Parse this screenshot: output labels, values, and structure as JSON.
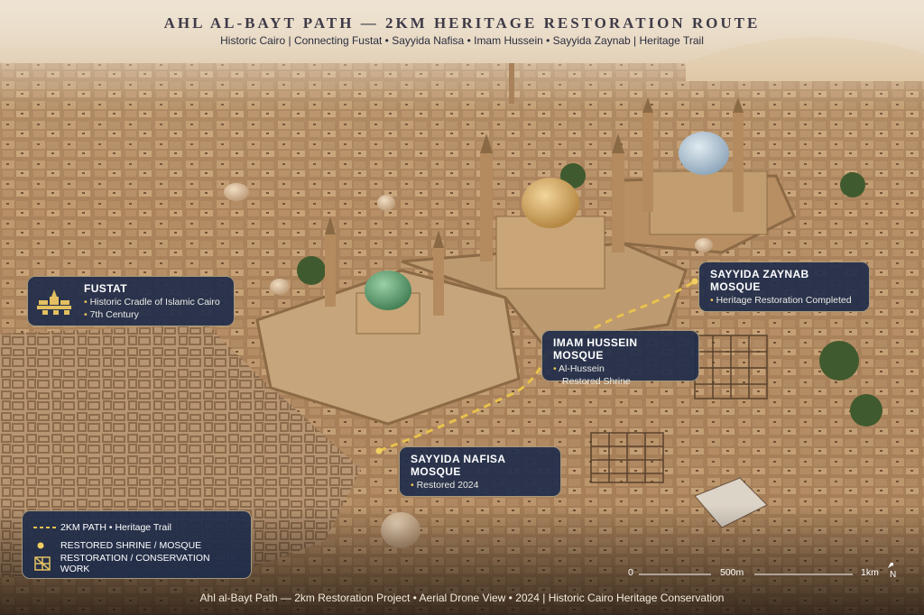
{
  "header": {
    "title": "AHL AL-BAYT PATH — 2KM HERITAGE RESTORATION ROUTE",
    "subtitle": "Historic Cairo | Connecting Fustat • Sayyida Nafisa • Imam Hussein • Sayyida Zaynab | Heritage Trail"
  },
  "labels": {
    "fustat": {
      "title": "FUSTAT",
      "lines": [
        "Historic Cradle of Islamic Cairo",
        "7th Century"
      ],
      "icon": "ruins-icon"
    },
    "zaynab": {
      "title": "SAYYIDA ZAYNAB MOSQUE",
      "lines": [
        "Heritage Restoration Completed"
      ]
    },
    "hussein": {
      "title": "IMAM HUSSEIN MOSQUE",
      "lines": [
        "Al-Hussein",
        "Restored Shrine"
      ]
    },
    "nafisa": {
      "title": "SAYYIDA NAFISA MOSQUE",
      "lines": [
        "Restored 2024"
      ]
    }
  },
  "legend": {
    "path": "2KM PATH • Heritage Trail",
    "shrine": "RESTORED SHRINE / MOSQUE",
    "restoration": "RESTORATION / CONSERVATION WORK"
  },
  "scale": {
    "start": "0",
    "mid": "500m",
    "end": "1km",
    "north": "N"
  },
  "footer": "Ahl al-Bayt Path — 2km Restoration Project • Aerial Drone View • 2024 | Historic Cairo Heritage Conservation",
  "colors": {
    "path": "#e8c24d",
    "label_bg": "#202c4a",
    "dome_gold": "#d3a55a",
    "dome_green": "#5e9a6e",
    "dome_blue": "#a8bccb"
  }
}
